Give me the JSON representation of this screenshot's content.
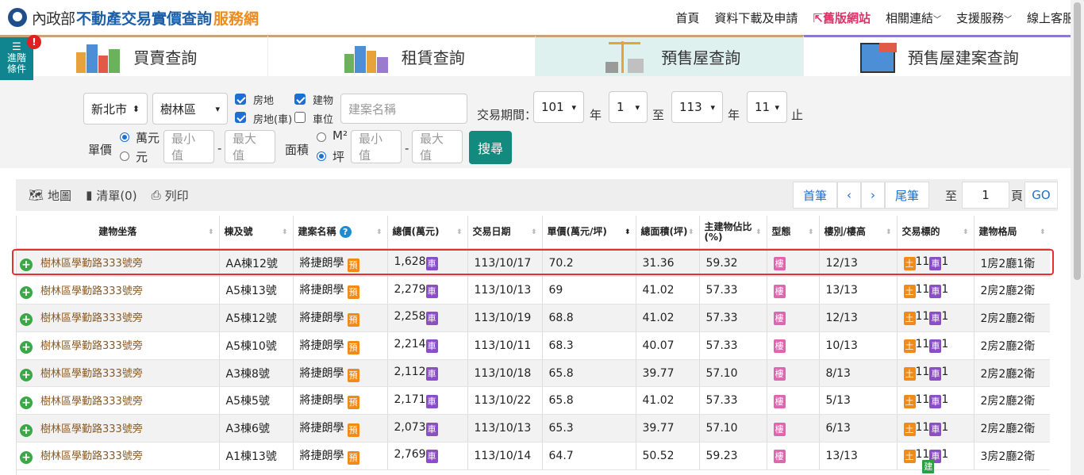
{
  "header": {
    "org": "內政部",
    "title": "不動產交易實價查詢",
    "title_suffix": "服務網",
    "nav": [
      "首頁",
      "資料下載及申請",
      "舊版網站",
      "相關連結",
      "支援服務",
      "線上客服"
    ]
  },
  "adv_filter": {
    "label_line1": "進階",
    "label_line2": "條件",
    "badge": "!"
  },
  "tabs": [
    "買賣查詢",
    "租賃查詢",
    "預售屋查詢",
    "預售屋建案查詢"
  ],
  "filters": {
    "city": "新北市",
    "district": "樹林區",
    "cb_land_house": "房地",
    "cb_building": "建物",
    "cb_land_house_car": "房地(車)",
    "cb_parking": "車位",
    "project_placeholder": "建案名稱",
    "period_label": "交易期間：",
    "year_from": "101",
    "month_from": "1",
    "year_to": "113",
    "month_to": "11",
    "year_unit": "年",
    "to_label": "至",
    "end_label": "止",
    "unit_price_label": "單價",
    "unit_wan": "萬元",
    "unit_yuan": "元",
    "min_placeholder": "最小值",
    "max_placeholder": "最大值",
    "dash": "-",
    "area_label": "面積",
    "area_m2": "M²",
    "area_ping": "坪",
    "search_label": "搜尋"
  },
  "toolbar": {
    "map": "地圖",
    "list": "清單(0)",
    "print": "列印",
    "first": "首筆",
    "prev": "‹",
    "next": "›",
    "last": "尾筆",
    "to": "至",
    "page": "1",
    "page_unit": "頁",
    "go": "GO"
  },
  "table": {
    "headers": [
      "建物坐落",
      "棟及號",
      "建案名稱",
      "總價(萬元)",
      "交易日期",
      "單價(萬元/坪)",
      "總面積(坪)",
      "主建物佔比(%)",
      "型態",
      "樓別/樓高",
      "交易標的",
      "建物格局"
    ],
    "tags": {
      "car": "車",
      "pre": "預",
      "lou": "樓",
      "land": "土",
      "bld": "建"
    },
    "rows": [
      {
        "addr": "樹林區學勤路333號旁",
        "unit": "AA棟12號",
        "project": "將捷朗學",
        "total": "1,628",
        "date": "113/10/17",
        "price": "70.2",
        "area": "31.36",
        "ratio": "59.32",
        "floor": "12/13",
        "layout": "1房2廳1衛"
      },
      {
        "addr": "樹林區學勤路333號旁",
        "unit": "A5棟13號",
        "project": "將捷朗學",
        "total": "2,279",
        "date": "113/10/13",
        "price": "69",
        "area": "41.02",
        "ratio": "57.33",
        "floor": "13/13",
        "layout": "2房2廳2衛"
      },
      {
        "addr": "樹林區學勤路333號旁",
        "unit": "A5棟12號",
        "project": "將捷朗學",
        "total": "2,258",
        "date": "113/10/19",
        "price": "68.8",
        "area": "41.02",
        "ratio": "57.33",
        "floor": "12/13",
        "layout": "2房2廳2衛"
      },
      {
        "addr": "樹林區學勤路333號旁",
        "unit": "A5棟10號",
        "project": "將捷朗學",
        "total": "2,214",
        "date": "113/10/11",
        "price": "68.3",
        "area": "40.07",
        "ratio": "57.33",
        "floor": "10/13",
        "layout": "2房2廳2衛"
      },
      {
        "addr": "樹林區學勤路333號旁",
        "unit": "A3棟8號",
        "project": "將捷朗學",
        "total": "2,112",
        "date": "113/10/18",
        "price": "65.8",
        "area": "39.77",
        "ratio": "57.10",
        "floor": "8/13",
        "layout": "2房2廳2衛"
      },
      {
        "addr": "樹林區學勤路333號旁",
        "unit": "A5棟5號",
        "project": "將捷朗學",
        "total": "2,171",
        "date": "113/10/22",
        "price": "65.8",
        "area": "41.02",
        "ratio": "57.33",
        "floor": "5/13",
        "layout": "2房2廳2衛"
      },
      {
        "addr": "樹林區學勤路333號旁",
        "unit": "A3棟6號",
        "project": "將捷朗學",
        "total": "2,073",
        "date": "113/10/13",
        "price": "65.3",
        "area": "39.77",
        "ratio": "57.10",
        "floor": "6/13",
        "layout": "2房2廳2衛"
      },
      {
        "addr": "樹林區學勤路333號旁",
        "unit": "A1棟13號",
        "project": "將捷朗學",
        "total": "2,769",
        "date": "113/10/14",
        "price": "64.7",
        "area": "50.52",
        "ratio": "59.23",
        "floor": "13/13",
        "layout": "3房2廳2衛"
      }
    ]
  },
  "colors": {
    "brand": "#1c5fa8",
    "accent": "#f08a18",
    "teal": "#138a7e",
    "highlight": "#e53030"
  }
}
